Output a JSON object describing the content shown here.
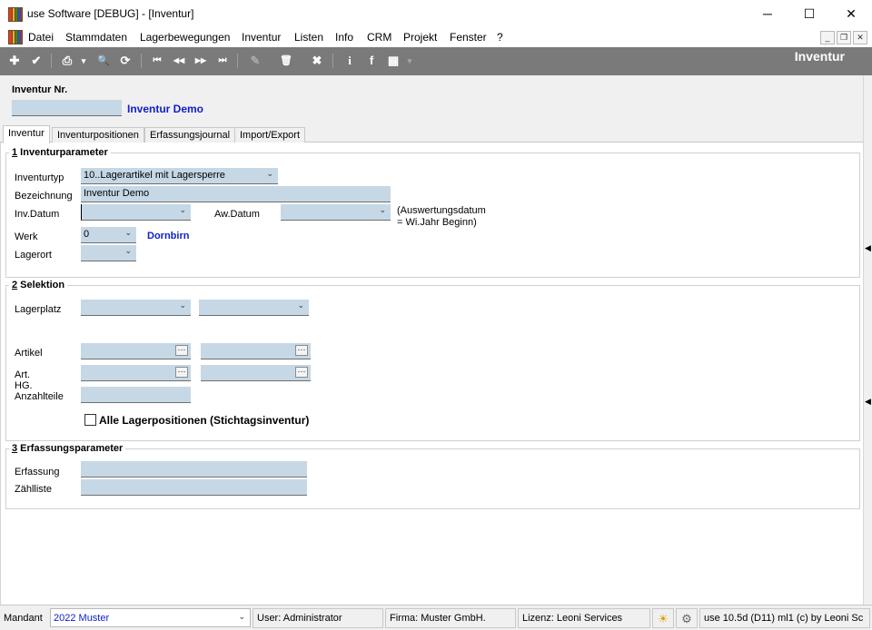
{
  "window": {
    "title": "use Software [DEBUG] - [Inventur]",
    "minimize": "─",
    "maximize": "☐",
    "close": "✕"
  },
  "menu": {
    "items": [
      "Datei",
      "Stammdaten",
      "Lagerbewegungen",
      "Inventur",
      "Listen",
      "Info",
      "CRM",
      "Projekt",
      "Fenster",
      "?"
    ],
    "mdi_minimize": "_",
    "mdi_restore": "❐",
    "mdi_close": "✕"
  },
  "toolbar": {
    "form_title": "Inventur",
    "icons": {
      "new": "✚",
      "save": "✔",
      "print": "⎙",
      "print_dropdown": "▾",
      "search": "🔍",
      "refresh": "⟳",
      "first": "⏮",
      "prev": "◀◀",
      "next": "▶▶",
      "last": "⏭",
      "edit": "✎",
      "delete": "🗑",
      "cancel": "✖",
      "info": "i",
      "facebook": "f",
      "grid": "▦",
      "grid_dropdown": "▾"
    }
  },
  "header": {
    "inventur_nr_label": "Inventur Nr.",
    "inventur_nr_value": "",
    "inventur_name": "Inventur Demo"
  },
  "tabs": [
    "Inventur",
    "Inventurpositionen",
    "Erfassungsjournal",
    "Import/Export"
  ],
  "section1": {
    "number": "1",
    "title": " Inventurparameter",
    "inventurtyp_label": "Inventurtyp",
    "inventurtyp_value": "10..Lagerartikel mit Lagersperre",
    "bezeichnung_label": "Bezeichnung",
    "bezeichnung_value": "Inventur Demo",
    "invdatum_label": "Inv.Datum",
    "invdatum_value": "",
    "awdatum_label": "Aw.Datum",
    "awdatum_value": "",
    "aw_note_line1": "(Auswertungsdatum",
    "aw_note_line2": "= Wi.Jahr Beginn)",
    "werk_label": "Werk",
    "werk_value": "0",
    "werk_name": "Dornbirn",
    "lagerort_label": "Lagerort",
    "lagerort_value": ""
  },
  "section2": {
    "number": "2",
    "title": " Selektion",
    "lagerplatz_label": "Lagerplatz",
    "lagerplatz_from": "",
    "lagerplatz_to": "",
    "artikel_label": "Artikel",
    "artikel_from": "",
    "artikel_to": "",
    "arthg_label_line1": "Art.",
    "arthg_label_line2": "HG.",
    "arthg_from": "",
    "arthg_to": "",
    "anzahlteile_label": "Anzahlteile",
    "anzahlteile_value": "",
    "alle_lagerpositionen_label": "Alle Lagerpositionen (Stichtagsinventur)",
    "alle_lagerpositionen_checked": false,
    "ellipsis": "···",
    "dropdown_arrow": "⌄"
  },
  "section3": {
    "number": "3",
    "title": " Erfassungsparameter",
    "erfassung_label": "Erfassung",
    "erfassung_value": "",
    "zaehlliste_label": "Zählliste",
    "zaehlliste_value": ""
  },
  "statusbar": {
    "mandant_label": "Mandant",
    "mandant_value": "2022 Muster",
    "user": "User: Administrator",
    "firma": "Firma: Muster GmbH.",
    "lizenz": "Lizenz: Leoni Services",
    "version": "use 10.5d (D11) ml1 (c) by Leoni Sc",
    "sun_icon": "☀",
    "tools_icon": "⚙"
  },
  "colors": {
    "input_bg": "#c6d8e6",
    "toolbar_bg": "#7a7a7a",
    "link_blue": "#1020c8"
  }
}
